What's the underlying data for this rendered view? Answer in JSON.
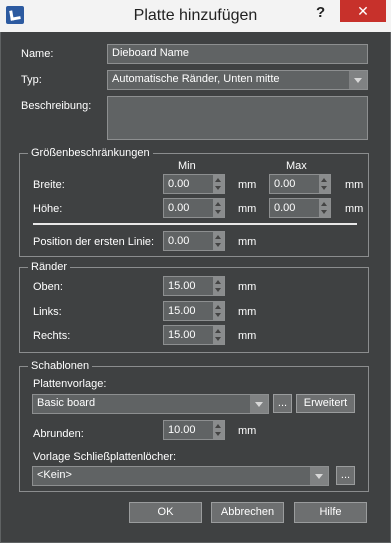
{
  "titlebar": {
    "title": "Platte hinzufügen",
    "help": "?",
    "close": "✕"
  },
  "name": {
    "label": "Name:",
    "value": "Dieboard Name"
  },
  "typ": {
    "label": "Typ:",
    "value": "Automatische Ränder, Unten mitte"
  },
  "beschreibung": {
    "label": "Beschreibung:",
    "value": ""
  },
  "groessen": {
    "title": "Größenbeschränkungen",
    "min_header": "Min",
    "max_header": "Max",
    "breite": {
      "label": "Breite:",
      "min": "0.00",
      "max": "0.00"
    },
    "hoehe": {
      "label": "Höhe:",
      "min": "0.00",
      "max": "0.00"
    },
    "erste_linie": {
      "label": "Position der ersten Linie:",
      "value": "0.00"
    },
    "unit": "mm"
  },
  "raender": {
    "title": "Ränder",
    "oben": {
      "label": "Oben:",
      "value": "15.00"
    },
    "links": {
      "label": "Links:",
      "value": "15.00"
    },
    "rechts": {
      "label": "Rechts:",
      "value": "15.00"
    },
    "unit": "mm"
  },
  "schablonen": {
    "title": "Schablonen",
    "plattenvorlage_label": "Plattenvorlage:",
    "plattenvorlage_value": "Basic board",
    "browse": "...",
    "erweitert": "Erweitert",
    "abrunden_label": "Abrunden:",
    "abrunden_value": "10.00",
    "unit": "mm",
    "schliess_label": "Vorlage Schließplattenlöcher:",
    "schliess_value": "<Kein>",
    "browse2": "..."
  },
  "buttons": {
    "ok": "OK",
    "cancel": "Abbrechen",
    "help": "Hilfe"
  }
}
